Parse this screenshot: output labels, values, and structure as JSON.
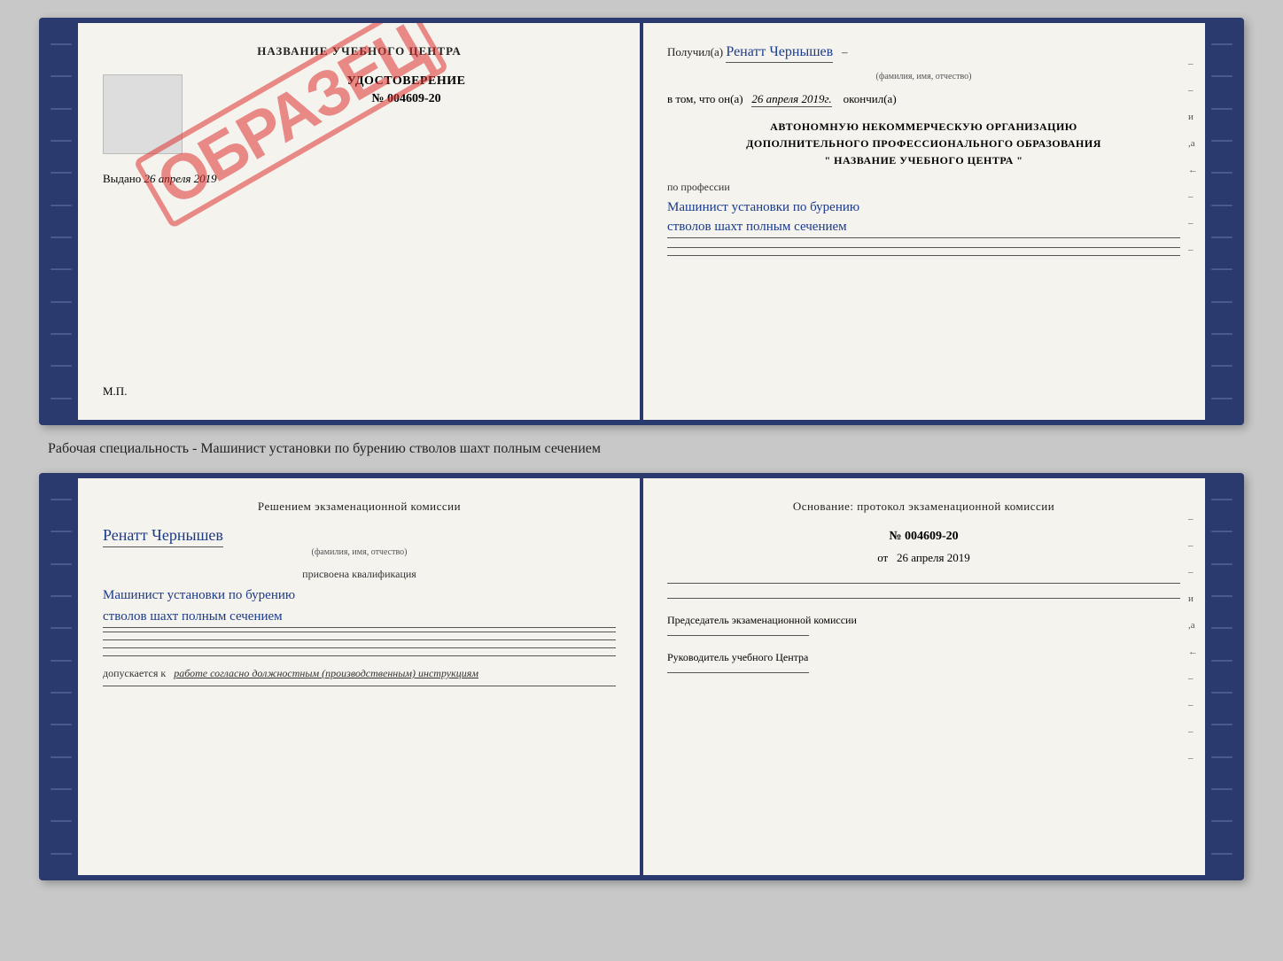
{
  "top_book": {
    "left_page": {
      "title": "НАЗВАНИЕ УЧЕБНОГО ЦЕНТРА",
      "stamp_text": "ОБРАЗЕЦ",
      "doc_title": "УДОСТОВЕРЕНИЕ",
      "doc_number": "№ 004609-20",
      "issued_label": "Выдано",
      "issued_date": "26 апреля 2019",
      "mp_label": "М.П."
    },
    "right_page": {
      "received_label": "Получил(а)",
      "received_name": "Ренатт Чернышев",
      "received_caption": "(фамилия, имя, отчество)",
      "date_prefix": "в том, что он(а)",
      "date_value": "26 апреля 2019г.",
      "date_suffix": "окончил(а)",
      "org_line1": "АВТОНОМНУЮ НЕКОММЕРЧЕСКУЮ ОРГАНИЗАЦИЮ",
      "org_line2": "ДОПОЛНИТЕЛЬНОГО ПРОФЕССИОНАЛЬНОГО ОБРАЗОВАНИЯ",
      "org_line3": "\"   НАЗВАНИЕ УЧЕБНОГО ЦЕНТРА   \"",
      "profession_label": "по профессии",
      "profession_value_line1": "Машинист установки по бурению",
      "profession_value_line2": "стволов шахт полным сечением",
      "margin_marks": [
        "–",
        "–",
        "и",
        ",а",
        "←",
        "–",
        "–",
        "–"
      ]
    }
  },
  "specialty_text": "Рабочая специальность - Машинист установки по бурению стволов шахт полным сечением",
  "bottom_book": {
    "left_page": {
      "title": "Решением  экзаменационной  комиссии",
      "name_value": "Ренатт Чернышев",
      "name_caption": "(фамилия, имя, отчество)",
      "qual_label": "присвоена квалификация",
      "qual_line1": "Машинист установки по бурению",
      "qual_line2": "стволов шахт полным сечением",
      "допуск_label": "допускается к",
      "допуск_value": "работе согласно должностным (производственным) инструкциям"
    },
    "right_page": {
      "title": "Основание:  протокол  экзаменационной  комиссии",
      "protocol_number": "№  004609-20",
      "date_prefix": "от",
      "date_value": "26 апреля 2019",
      "chairman_label": "Председатель экзаменационной комиссии",
      "head_label": "Руководитель учебного Центра",
      "margin_marks": [
        "–",
        "–",
        "–",
        "и",
        ",а",
        "←",
        "–",
        "–",
        "–",
        "–"
      ]
    }
  }
}
